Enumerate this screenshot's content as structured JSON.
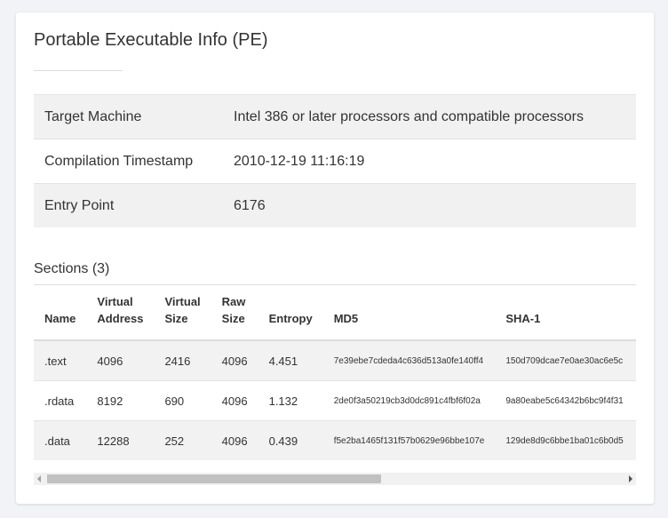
{
  "title": "Portable Executable Info (PE)",
  "info": [
    {
      "key": "Target Machine",
      "value": "Intel 386 or later processors and compatible processors"
    },
    {
      "key": "Compilation Timestamp",
      "value": "2010-12-19 11:16:19"
    },
    {
      "key": "Entry Point",
      "value": "6176"
    }
  ],
  "sections": {
    "heading": "Sections (3)",
    "columns": {
      "name": "Name",
      "virtual_address": [
        "Virtual",
        "Address"
      ],
      "virtual_size": [
        "Virtual",
        "Size"
      ],
      "raw_size": [
        "Raw",
        "Size"
      ],
      "entropy": "Entropy",
      "md5": "MD5",
      "sha1": "SHA-1"
    },
    "rows": [
      {
        "name": ".text",
        "virtual_address": "4096",
        "virtual_size": "2416",
        "raw_size": "4096",
        "entropy": "4.451",
        "md5": "7e39ebe7cdeda4c636d513a0fe140ff4",
        "sha1": "150d709dcae7e0ae30ac6e5c"
      },
      {
        "name": ".rdata",
        "virtual_address": "8192",
        "virtual_size": "690",
        "raw_size": "4096",
        "entropy": "1.132",
        "md5": "2de0f3a50219cb3d0dc891c4fbf6f02a",
        "sha1": "9a80eabe5c64342b6bc9f4f31"
      },
      {
        "name": ".data",
        "virtual_address": "12288",
        "virtual_size": "252",
        "raw_size": "4096",
        "entropy": "0.439",
        "md5": "f5e2ba1465f131f57b0629e96bbe107e",
        "sha1": "129de8d9c6bbe1ba01c6b0d5"
      }
    ]
  },
  "scrollbar": {
    "position": 0,
    "left_arrow_icon": "scroll-left-arrow",
    "right_arrow_icon": "scroll-right-arrow"
  }
}
